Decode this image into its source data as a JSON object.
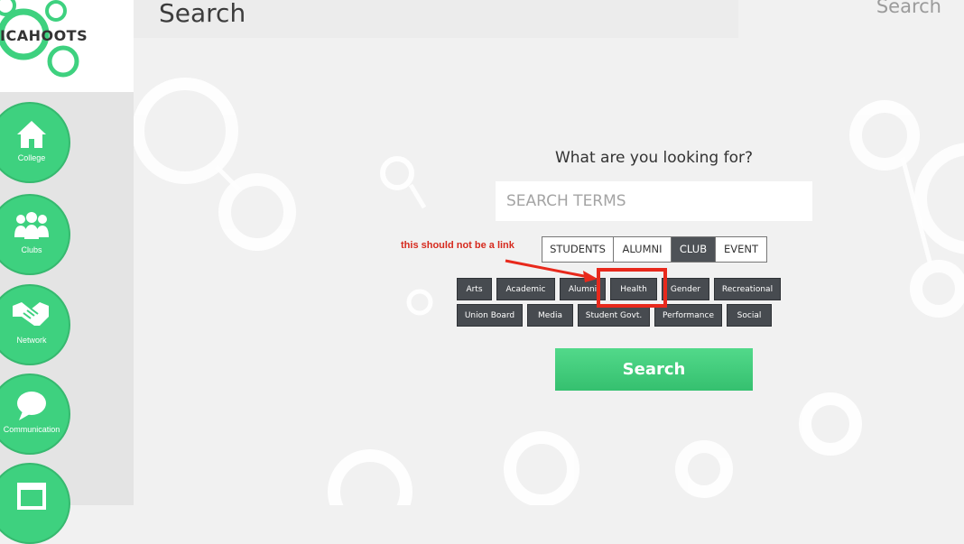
{
  "app": {
    "logo_text": "ICAHOOTS"
  },
  "header": {
    "title": "Search",
    "search_link": "Search"
  },
  "sidebar": {
    "items": [
      {
        "label": "College",
        "icon": "home-icon"
      },
      {
        "label": "Clubs",
        "icon": "people-icon"
      },
      {
        "label": "Network",
        "icon": "handshake-icon"
      },
      {
        "label": "Communication",
        "icon": "speech-bubble-icon"
      },
      {
        "label": "",
        "icon": "calendar-icon"
      }
    ]
  },
  "search": {
    "prompt": "What are you looking for?",
    "placeholder": "SEARCH TERMS",
    "types": [
      {
        "label": "STUDENTS",
        "active": false
      },
      {
        "label": "ALUMNI",
        "active": false
      },
      {
        "label": "CLUB",
        "active": true
      },
      {
        "label": "EVENT",
        "active": false
      }
    ],
    "tags_row1": [
      "Arts",
      "Academic",
      "Alumni",
      "Health",
      "Gender",
      "Recreational"
    ],
    "tags_row2": [
      "Union Board",
      "Media",
      "Student Govt.",
      "Performance",
      "Social"
    ],
    "button_label": "Search"
  },
  "annotation": {
    "note": "this should not be a link",
    "highlighted_tag": "Health",
    "color": "#e8291c"
  },
  "colors": {
    "brand_green": "#3ed17f",
    "tag_dark": "#474b50",
    "button_green": "#44cc7d"
  }
}
